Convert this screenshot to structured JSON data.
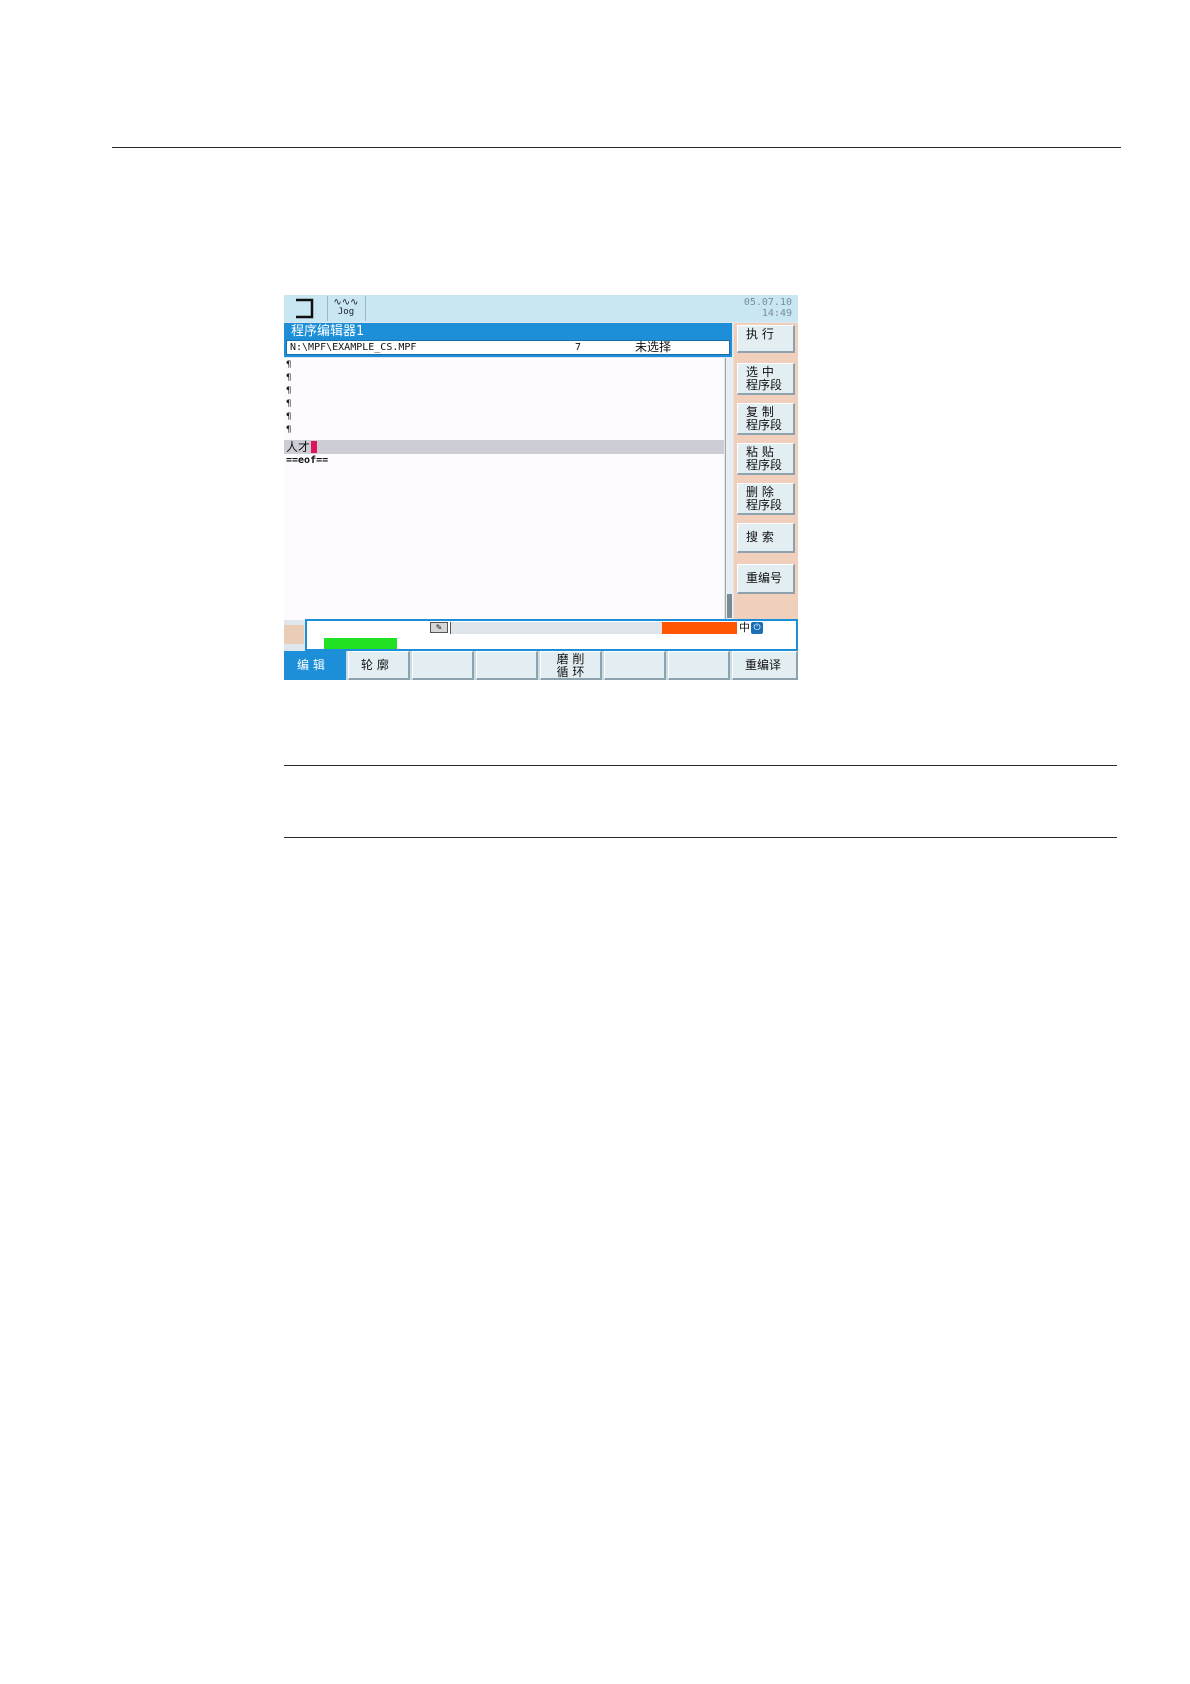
{
  "screen": {
    "mode_icon": "mode-bracket-icon",
    "jog": {
      "icon": "jog-wave-icon",
      "glyph": "∿∿∿",
      "label": "Jog"
    },
    "date": "05.07.10",
    "time": "14:49"
  },
  "editor": {
    "title": "程序编辑器1",
    "path": "N:\\MPF\\EXAMPLE_CS.MPF",
    "number": "7",
    "selection_status": "未选择",
    "lines": [
      "¶",
      "¶",
      "¶",
      "¶",
      "¶",
      "¶"
    ],
    "current_line": "人才",
    "eof": "==eof=="
  },
  "softkeys_vertical": [
    {
      "line1": "执 行",
      "line2": ""
    },
    {
      "line1": "选   中",
      "line2": "程序段"
    },
    {
      "line1": "复   制",
      "line2": "程序段"
    },
    {
      "line1": "粘   贴",
      "line2": "程序段"
    },
    {
      "line1": "删   除",
      "line2": "程序段"
    },
    {
      "line1": "搜 索",
      "line2": ""
    },
    {
      "line1": "重编号",
      "line2": ""
    }
  ],
  "status": {
    "input_indicator": "中",
    "edit_icon": "edit-pencil-icon",
    "power_icon": "power-icon",
    "green_color": "#22e022",
    "orange_color": "#ff5500"
  },
  "softkeys_horizontal": [
    {
      "line1": "编 辑",
      "line2": "",
      "active": true
    },
    {
      "line1": "轮 廓",
      "line2": ""
    },
    {
      "line1": "",
      "line2": ""
    },
    {
      "line1": "",
      "line2": ""
    },
    {
      "line1": "磨 削",
      "line2": "循 环"
    },
    {
      "line1": "",
      "line2": ""
    },
    {
      "line1": "",
      "line2": ""
    },
    {
      "line1": "重编译",
      "line2": ""
    }
  ],
  "colors": {
    "accent": "#1c8fd8",
    "softkey_bg": "#e3eef2",
    "softkey_panel": "#f0d0bc"
  }
}
